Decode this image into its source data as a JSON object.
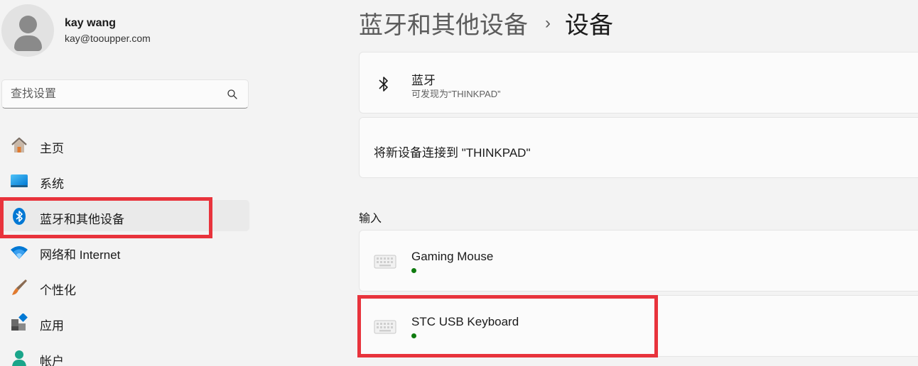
{
  "user": {
    "name": "kay wang",
    "email": "kay@tooupper.com"
  },
  "search": {
    "placeholder": "查找设置",
    "icon": "search-icon"
  },
  "sidebar": {
    "items": [
      {
        "label": "主页",
        "icon": "home-icon"
      },
      {
        "label": "系统",
        "icon": "system-display-icon"
      },
      {
        "label": "蓝牙和其他设备",
        "icon": "bluetooth-icon",
        "active": true
      },
      {
        "label": "网络和 Internet",
        "icon": "wifi-icon"
      },
      {
        "label": "个性化",
        "icon": "paintbrush-icon"
      },
      {
        "label": "应用",
        "icon": "apps-icon"
      },
      {
        "label": "帐户",
        "icon": "account-icon"
      }
    ]
  },
  "breadcrumb": {
    "parent": "蓝牙和其他设备",
    "separator": "›",
    "current": "设备"
  },
  "bluetooth_card": {
    "title": "蓝牙",
    "subtitle": "可发现为“THINKPAD”",
    "icon": "bluetooth-icon"
  },
  "connect_card": {
    "title": "将新设备连接到 \"THINKPAD\""
  },
  "input_section": {
    "label": "输入",
    "devices": [
      {
        "name": "Gaming Mouse",
        "icon": "keyboard-icon",
        "status_color": "#0f7b0f"
      },
      {
        "name": "STC USB Keyboard",
        "icon": "keyboard-icon",
        "status_color": "#0f7b0f"
      }
    ]
  },
  "colors": {
    "accent": "#0067c0",
    "highlight": "#e8333c",
    "status_connected": "#0f7b0f"
  }
}
